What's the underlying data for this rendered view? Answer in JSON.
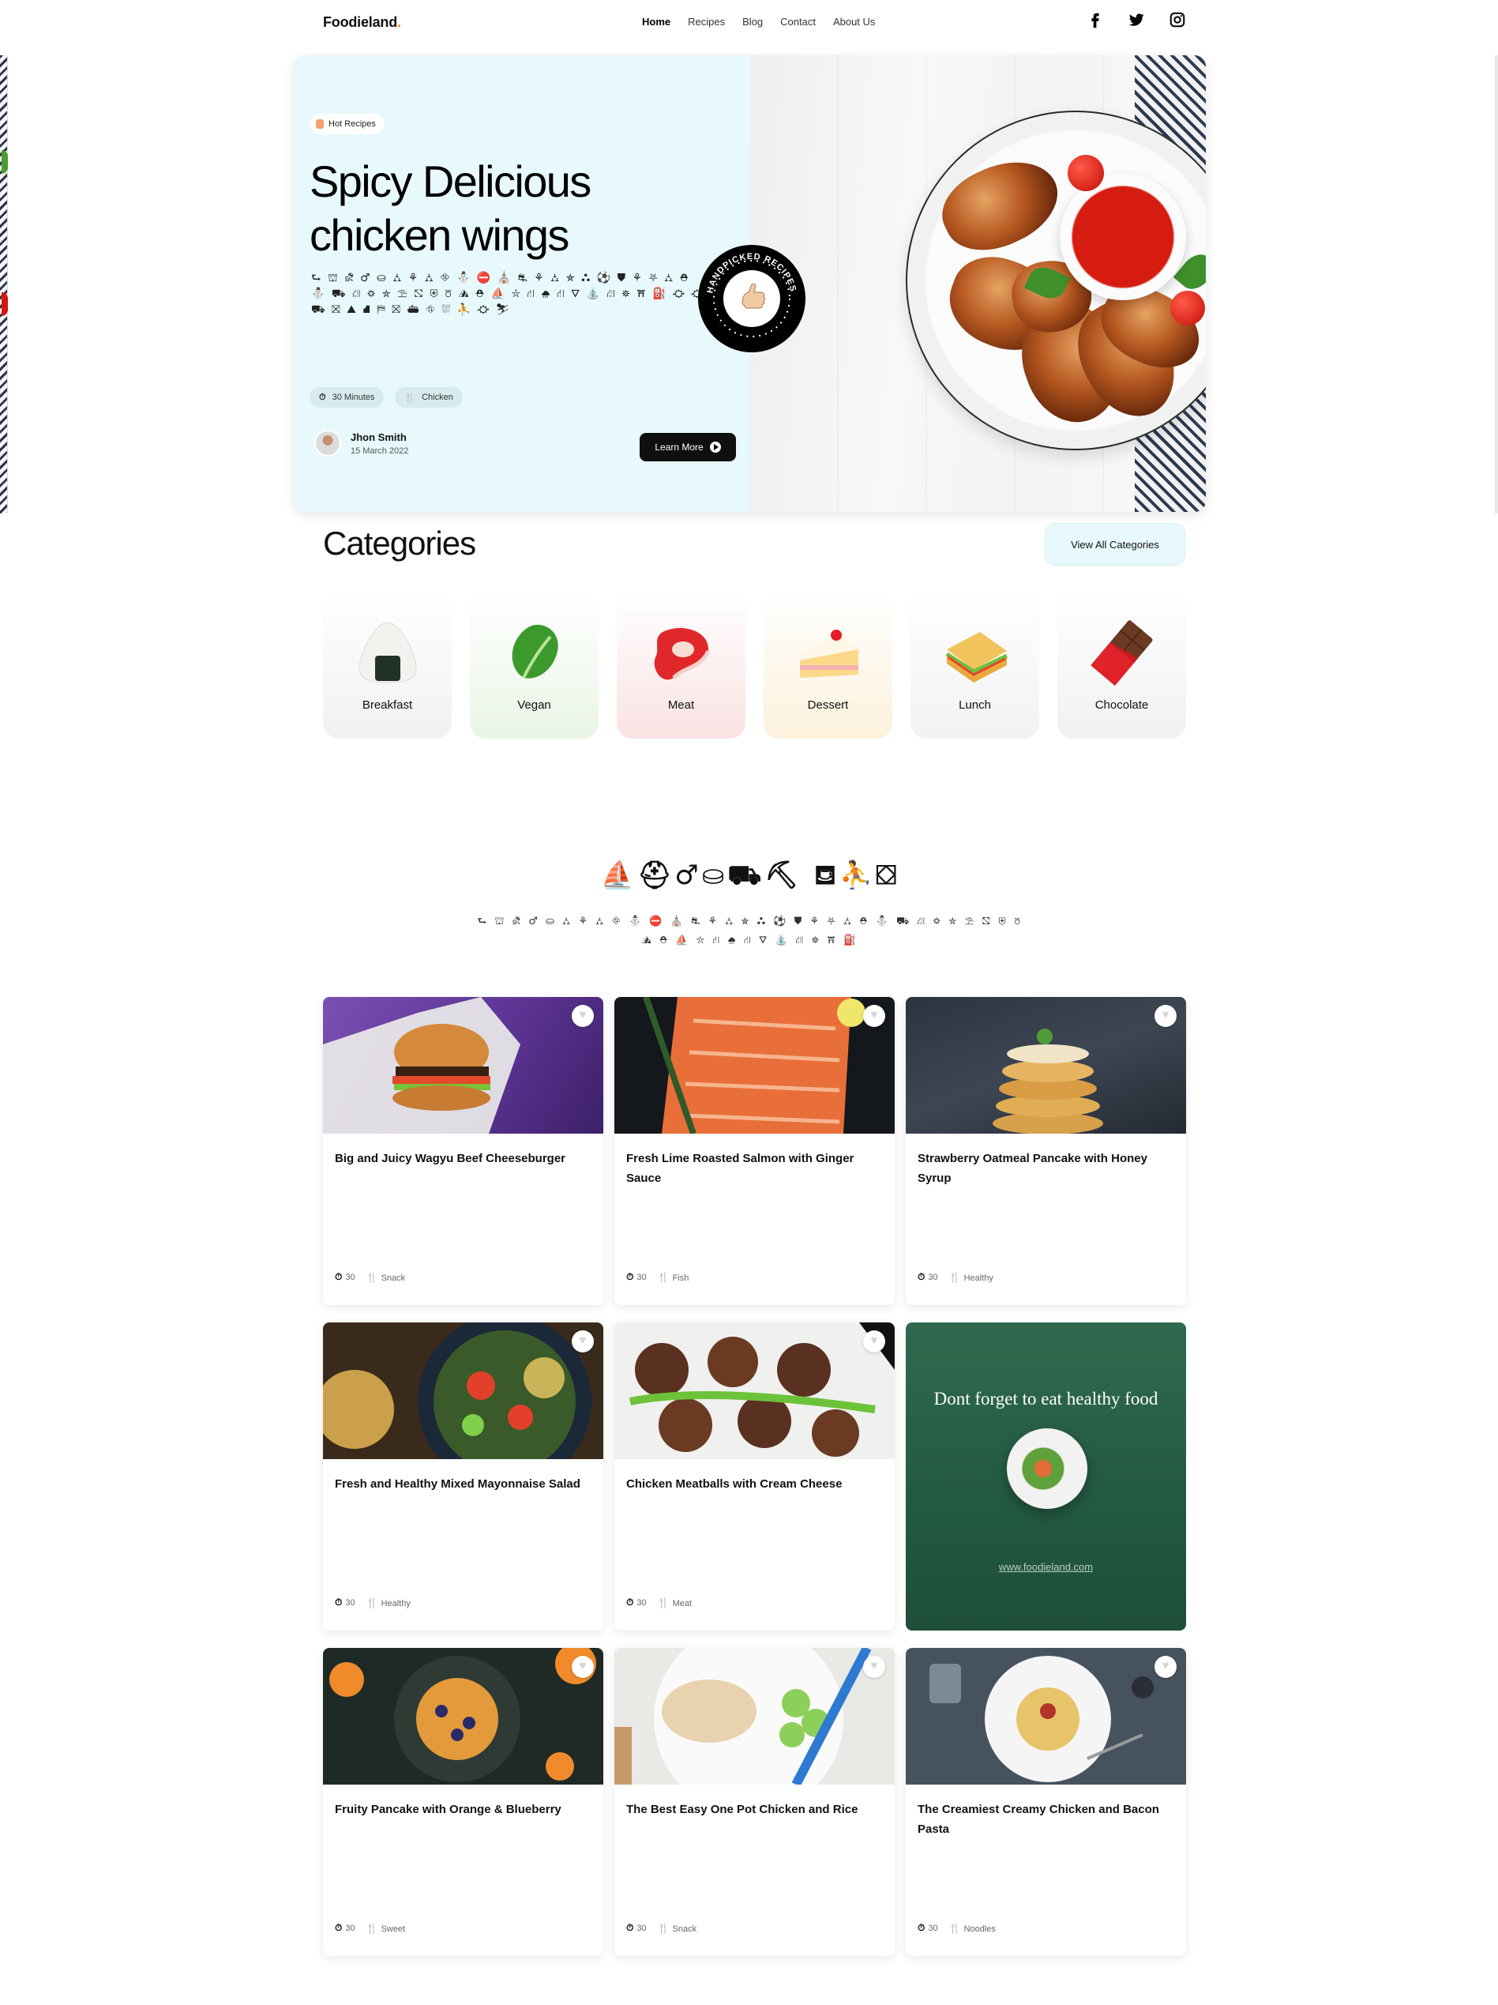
{
  "nav": {
    "brand": "Foodieland",
    "brand_dot": ".",
    "links": [
      "Home",
      "Recipes",
      "Blog",
      "Contact",
      "About Us"
    ],
    "active": "Home",
    "socials": [
      "facebook-icon",
      "twitter-icon",
      "instagram-icon"
    ]
  },
  "hero": {
    "badge": "Hot Recipes",
    "title": "Spicy Delicious chicken wings",
    "description": "⮑ ⛫ ⛐ ♂ ⛀ ⛼ ⚘ ⛼ ⛗ ⛄ ⛔ ⛪ ⛐ ⚘ ⛼ ⛤ ⛬ ⚽ ⛊ ⚘ ⛧ ⛼ ⛑ ⛄ ⛟ ⛜ ⛭ ⛦ ⛱ ⛞ ⛨ ⛣ ⛰ ⛑ ⛵ ⛥ ⛙ ⛆ ⛙ ⛛ ⛲ ⛜ ⛯ ⛩ ⛽ ⛮ ⛮ ⛟ ⛝ ⛰ ⛘ ⛿ ⛝ ⛴ ⛗ ⛆ ⛹ ⛮ ⛷",
    "time": "30 Minutes",
    "category": "Chicken",
    "author_name": "Jhon Smith",
    "author_date": "15 March 2022",
    "cta": "Learn More",
    "stamp": "HANDPICKED RECIPES"
  },
  "categories": {
    "title": "Categories",
    "view_all": "View All Categories",
    "items": [
      {
        "label": "Breakfast",
        "icon": "onigiri-icon",
        "bg": "#f3f3f3"
      },
      {
        "label": "Vegan",
        "icon": "leafy-green-icon",
        "bg": "#eef7ec"
      },
      {
        "label": "Meat",
        "icon": "steak-icon",
        "bg": "#fbebeb"
      },
      {
        "label": "Dessert",
        "icon": "cake-icon",
        "bg": "#fcf6e8"
      },
      {
        "label": "Lunch",
        "icon": "sandwich-icon",
        "bg": "#f4f4f4"
      },
      {
        "label": "Chocolate",
        "icon": "chocolate-bar-icon",
        "bg": "#f3f3f3"
      }
    ]
  },
  "recipes": {
    "title": "⛵⛑♂⛀⛟⛏  ⛾⛹⛋",
    "subtitle": "⮑ ⛫ ⛐ ♂ ⛀ ⛼ ⚘ ⛼ ⛗ ⛄ ⛔ ⛪ ⛐ ⚘ ⛼ ⛤ ⛬ ⚽ ⛊ ⚘ ⛧ ⛼ ⛑ ⛄ ⛟ ⛜ ⛭ ⛦ ⛱ ⛞ ⛨ ⛣ ⛰ ⛑ ⛵ ⛥ ⛙ ⛆ ⛙ ⛛ ⛲ ⛜ ⛯ ⛩ ⛽",
    "cards": [
      {
        "title": "Big and Juicy Wagyu Beef Cheeseburger",
        "time": "30",
        "tag": "Snack",
        "img": "burger"
      },
      {
        "title": "Fresh Lime Roasted Salmon with Ginger Sauce",
        "time": "30",
        "tag": "Fish",
        "img": "salmon"
      },
      {
        "title": "Strawberry Oatmeal Pancake with Honey Syrup",
        "time": "30",
        "tag": "Healthy",
        "img": "pancake"
      },
      {
        "title": "Fresh and Healthy Mixed Mayonnaise Salad",
        "time": "30",
        "tag": "Healthy",
        "img": "salad"
      },
      {
        "title": "Chicken Meatballs with Cream Cheese",
        "time": "30",
        "tag": "Meat",
        "img": "meatballs"
      },
      {
        "title": "Fruity Pancake with Orange & Blueberry",
        "time": "30",
        "tag": "Sweet",
        "img": "fruity"
      },
      {
        "title": "The Best Easy One Pot Chicken and Rice",
        "time": "30",
        "tag": "Snack",
        "img": "chickenrice"
      },
      {
        "title": "The Creamiest Creamy Chicken and Bacon Pasta",
        "time": "30",
        "tag": "Noodles",
        "img": "pasta"
      }
    ],
    "promo": {
      "title": "Dont forget to eat healthy food",
      "link": "www.foodieland.com"
    }
  }
}
